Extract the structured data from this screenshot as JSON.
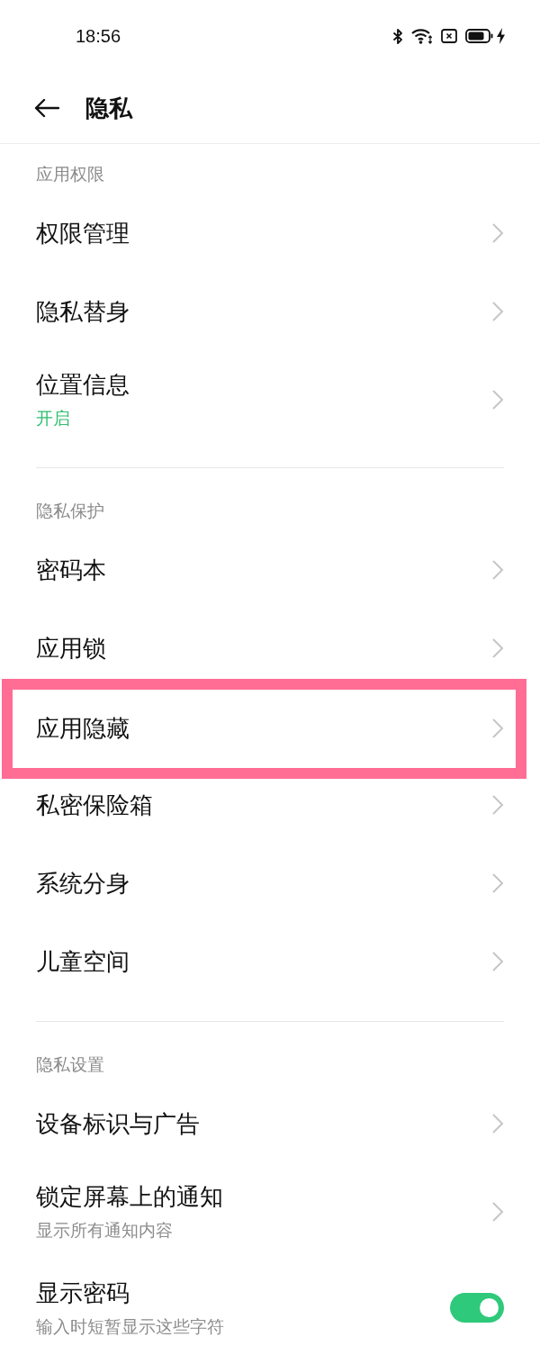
{
  "status_bar": {
    "time": "18:56"
  },
  "header": {
    "title": "隐私"
  },
  "sections": [
    {
      "title": "应用权限",
      "items": [
        {
          "label": "权限管理",
          "kind": "link",
          "highlighted": false
        },
        {
          "label": "隐私替身",
          "kind": "link",
          "highlighted": false
        },
        {
          "label": "位置信息",
          "subtitle": {
            "text": "开启",
            "kind": "status"
          },
          "kind": "link",
          "highlighted": false
        }
      ]
    },
    {
      "title": "隐私保护",
      "items": [
        {
          "label": "密码本",
          "kind": "link",
          "highlighted": false
        },
        {
          "label": "应用锁",
          "kind": "link",
          "highlighted": false
        },
        {
          "label": "应用隐藏",
          "kind": "link",
          "highlighted": true
        },
        {
          "label": "私密保险箱",
          "kind": "link",
          "highlighted": false
        },
        {
          "label": "系统分身",
          "kind": "link",
          "highlighted": false
        },
        {
          "label": "儿童空间",
          "kind": "link",
          "highlighted": false
        }
      ]
    },
    {
      "title": "隐私设置",
      "items": [
        {
          "label": "设备标识与广告",
          "kind": "link",
          "highlighted": false
        },
        {
          "label": "锁定屏幕上的通知",
          "subtitle": {
            "text": "显示所有通知内容",
            "kind": "description"
          },
          "kind": "link",
          "highlighted": false
        },
        {
          "label": "显示密码",
          "subtitle": {
            "text": "输入时短暂显示这些字符",
            "kind": "description"
          },
          "kind": "toggle",
          "on": true,
          "highlighted": false
        }
      ]
    }
  ]
}
